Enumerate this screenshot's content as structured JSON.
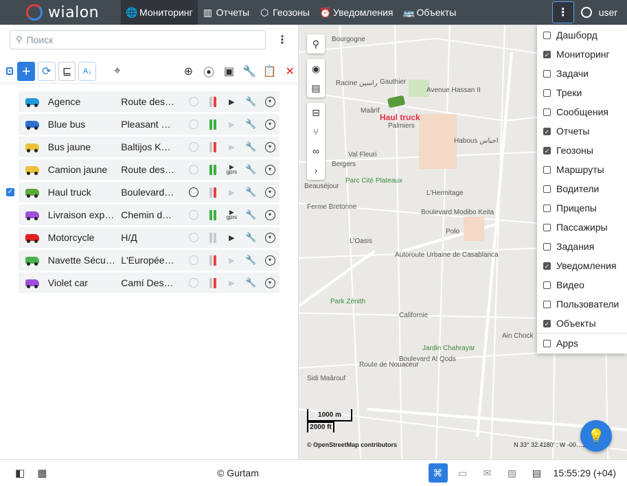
{
  "brand": {
    "logo_text": "wialon"
  },
  "nav": [
    {
      "label": "Мониторинг",
      "icon": "globe-icon",
      "active": true
    },
    {
      "label": "Отчеты",
      "icon": "report-icon"
    },
    {
      "label": "Геозоны",
      "icon": "geofence-icon"
    },
    {
      "label": "Уведомления",
      "icon": "alarm-icon"
    },
    {
      "label": "Объекты",
      "icon": "bus-icon"
    }
  ],
  "user": {
    "name": "user"
  },
  "search": {
    "placeholder": "Поиск"
  },
  "units": [
    {
      "name": "Agence",
      "address": "Route des …",
      "color": "#1f9ad6",
      "checked": false,
      "signal": [
        "#c6c9cc",
        "#e84040"
      ],
      "play": "dark",
      "gprs": false
    },
    {
      "name": "Blue bus",
      "address": "Pleasant S…",
      "color": "#2f6fd1",
      "checked": false,
      "signal": [
        "#3cb043",
        "#3cb043"
      ],
      "play": "grey",
      "gprs": false
    },
    {
      "name": "Bus jaune",
      "address": "Baltijos Ke…",
      "color": "#e8c23a",
      "checked": false,
      "signal": [
        "#c6c9cc",
        "#e84040"
      ],
      "play": "grey",
      "gprs": false
    },
    {
      "name": "Camion jaune",
      "address": "Route des …",
      "color": "#e8c23a",
      "checked": false,
      "signal": [
        "#3cb043",
        "#3cb043"
      ],
      "play": "dark",
      "gprs": true
    },
    {
      "name": "Haul truck",
      "address": "Boulevard …",
      "color": "#5aa93a",
      "checked": true,
      "signal": [
        "#c6c9cc",
        "#e84040"
      ],
      "play": "grey",
      "gprs": false
    },
    {
      "name": "Livraison exp…",
      "address": "Chemin d…",
      "color": "#a04fd8",
      "checked": false,
      "signal": [
        "#3cb043",
        "#3cb043"
      ],
      "play": "dark",
      "gprs": true
    },
    {
      "name": "Motorcycle",
      "address": "Н/Д",
      "color": "#e02020",
      "checked": false,
      "signal": [
        "#c6c9cc",
        "#c6c9cc"
      ],
      "play": "dark",
      "gprs": false
    },
    {
      "name": "Navette Sécu…",
      "address": "L'Européen…",
      "color": "#4caf50",
      "checked": false,
      "signal": [
        "#c6c9cc",
        "#e84040"
      ],
      "play": "grey",
      "gprs": false
    },
    {
      "name": "Violet car",
      "address": "Camí Des …",
      "color": "#a04fd8",
      "checked": false,
      "signal": [
        "#c6c9cc",
        "#e84040"
      ],
      "play": "grey",
      "gprs": false
    }
  ],
  "gprs_label": "gprs",
  "map": {
    "unit_label": "Haul truck",
    "labels": [
      {
        "text": "Bourgogne",
        "green": false
      },
      {
        "text": "Racine راسين",
        "green": false
      },
      {
        "text": "Gauthier",
        "green": false
      },
      {
        "text": "Maârif",
        "green": false
      },
      {
        "text": "Palmiers",
        "green": false
      },
      {
        "text": "Avenue Hassan II",
        "green": false
      },
      {
        "text": "Val Fleuri",
        "green": false
      },
      {
        "text": "Habous احباس",
        "green": false
      },
      {
        "text": "Bergers",
        "green": false
      },
      {
        "text": "Parc Cité Plateaux",
        "green": true
      },
      {
        "text": "Beauséjour",
        "green": false
      },
      {
        "text": "L'Hermitage",
        "green": false
      },
      {
        "text": "Ferme Bretonne",
        "green": false
      },
      {
        "text": "Boulevard Modibo Keita",
        "green": false
      },
      {
        "text": "L'Oasis",
        "green": false
      },
      {
        "text": "Polo",
        "green": false
      },
      {
        "text": "Autoroute Urbaine de Casablanca",
        "green": false
      },
      {
        "text": "Park Zénith",
        "green": true
      },
      {
        "text": "Californie",
        "green": false
      },
      {
        "text": "Jardin Chahrayar",
        "green": true
      },
      {
        "text": "Boulevard Al Qods",
        "green": false
      },
      {
        "text": "Sidi Maârouf",
        "green": false
      },
      {
        "text": "Route de Nouaceur",
        "green": false
      },
      {
        "text": "Ain Chock",
        "green": false
      }
    ],
    "scale_km": "1000 m",
    "scale_ft": "2000 ft",
    "attribution": "© OpenStreetMap contributors",
    "coords": "N 33° 32.4180′ : W -00…14′"
  },
  "menu": [
    {
      "label": "Дашборд",
      "checked": false
    },
    {
      "label": "Мониторинг",
      "checked": true
    },
    {
      "label": "Задачи",
      "checked": false
    },
    {
      "label": "Треки",
      "checked": false
    },
    {
      "label": "Сообщения",
      "checked": false
    },
    {
      "label": "Отчеты",
      "checked": true
    },
    {
      "label": "Геозоны",
      "checked": true
    },
    {
      "label": "Маршруты",
      "checked": false
    },
    {
      "label": "Водители",
      "checked": false
    },
    {
      "label": "Прицепы",
      "checked": false
    },
    {
      "label": "Пассажиры",
      "checked": false
    },
    {
      "label": "Задания",
      "checked": false
    },
    {
      "label": "Уведомления",
      "checked": true
    },
    {
      "label": "Видео",
      "checked": false
    },
    {
      "label": "Пользователи",
      "checked": false
    },
    {
      "label": "Объекты",
      "checked": true
    },
    {
      "label": "Apps",
      "checked": false
    }
  ],
  "footer": {
    "copyright": "© Gurtam",
    "time": "15:55:29 (+04)"
  },
  "colors": {
    "accent": "#2d7de0",
    "topbar": "#424a52"
  }
}
